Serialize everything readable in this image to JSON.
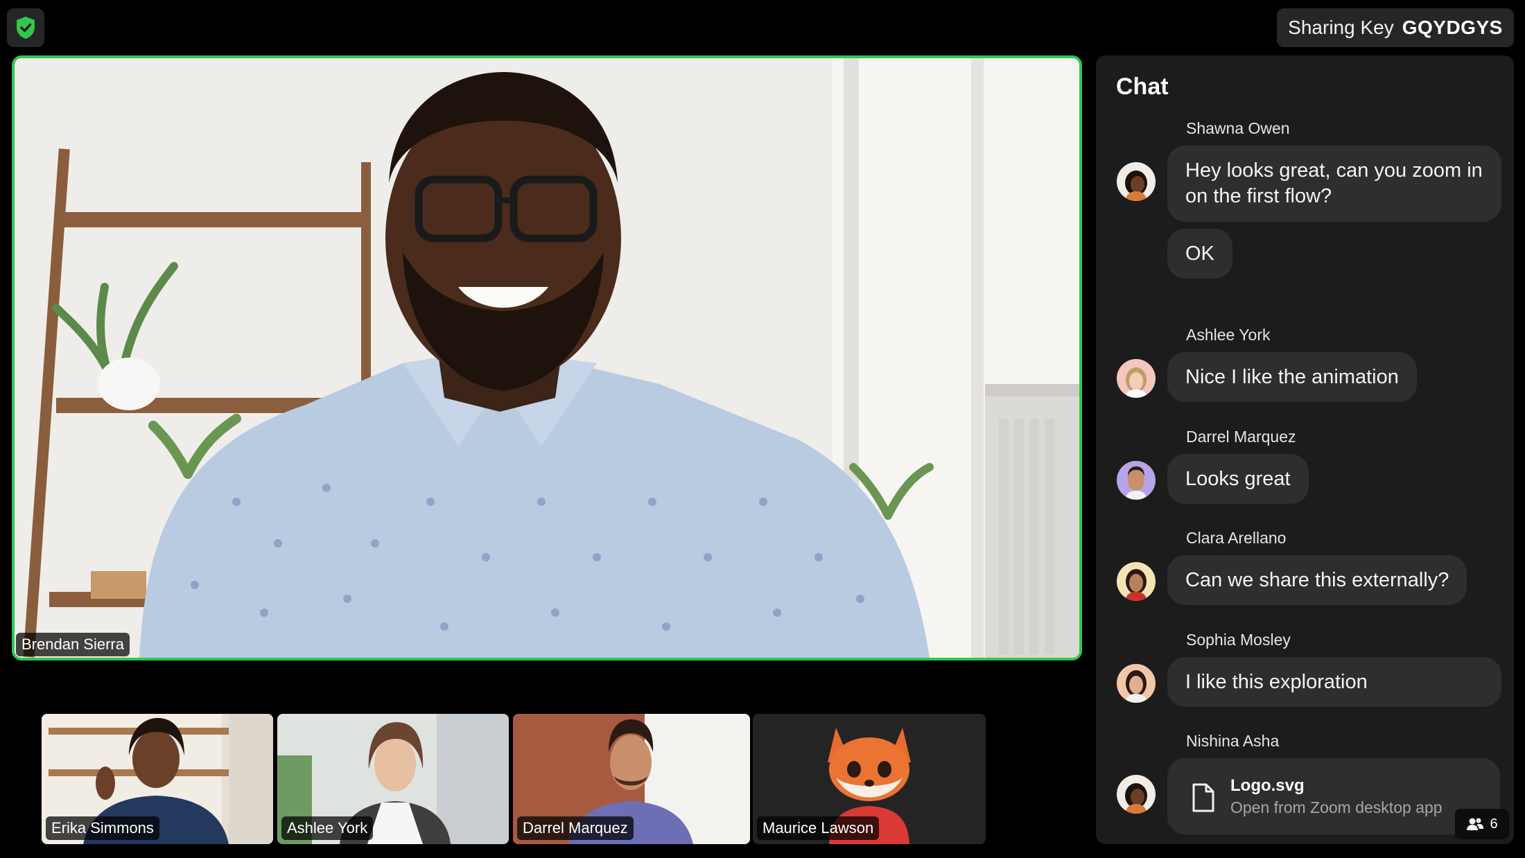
{
  "header": {
    "sharing_key_label": "Sharing Key",
    "sharing_key_value": "GQYDGYS"
  },
  "main_video": {
    "speaker_name": "Brendan Sierra",
    "active_border_color": "#2fc84a"
  },
  "thumbnails": [
    {
      "name": "Erika Simmons"
    },
    {
      "name": "Ashlee York"
    },
    {
      "name": "Darrel Marquez"
    },
    {
      "name": "Maurice Lawson"
    }
  ],
  "chat": {
    "title": "Chat",
    "messages": [
      {
        "sender": "Shawna Owen",
        "texts": [
          "Hey looks great, can you zoom in on the first flow?",
          "OK"
        ]
      },
      {
        "sender": "Ashlee York",
        "texts": [
          "Nice I like the animation"
        ]
      },
      {
        "sender": "Darrel Marquez",
        "texts": [
          "Looks great"
        ]
      },
      {
        "sender": "Clara Arellano",
        "texts": [
          "Can we share this externally?"
        ]
      },
      {
        "sender": "Sophia Mosley",
        "texts": [
          "I like this exploration"
        ]
      },
      {
        "sender": "Nishina Asha",
        "file": {
          "name": "Logo.svg",
          "subtitle": "Open from Zoom desktop app"
        }
      }
    ]
  },
  "participants": {
    "count": "6",
    "icon": "people-icon"
  },
  "icons": {
    "security": "shield-check-icon",
    "file": "file-icon"
  }
}
